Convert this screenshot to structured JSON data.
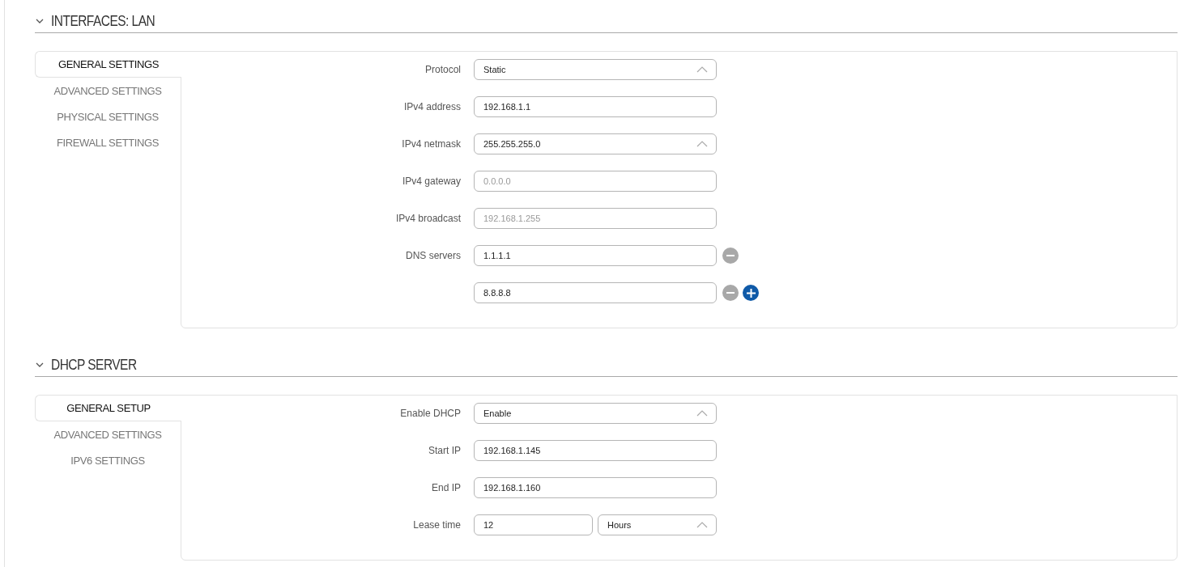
{
  "sections": [
    {
      "title": "INTERFACES: LAN",
      "expanded": true,
      "tabs": [
        {
          "label": "GENERAL SETTINGS",
          "selected": true
        },
        {
          "label": "ADVANCED SETTINGS",
          "selected": false
        },
        {
          "label": "PHYSICAL SETTINGS",
          "selected": false
        },
        {
          "label": "FIREWALL SETTINGS",
          "selected": false
        }
      ],
      "fields": [
        {
          "label": "Protocol",
          "kind": "select",
          "value": "Static"
        },
        {
          "label": "IPv4 address",
          "kind": "input",
          "value": "192.168.1.1"
        },
        {
          "label": "IPv4 netmask",
          "kind": "select",
          "value": "255.255.255.0"
        },
        {
          "label": "IPv4 gateway",
          "kind": "input",
          "placeholder": "0.0.0.0"
        },
        {
          "label": "IPv4 broadcast",
          "kind": "input",
          "placeholder": "192.168.1.255"
        },
        {
          "label": "DNS servers",
          "kind": "input",
          "value": "1.1.1.1",
          "actions": [
            {
              "kind": "remove"
            }
          ]
        },
        {
          "kind": "input",
          "value": "8.8.8.8",
          "actions": [
            {
              "kind": "remove"
            },
            {
              "kind": "add"
            }
          ]
        }
      ]
    },
    {
      "title": "DHCP SERVER",
      "expanded": true,
      "tabs": [
        {
          "label": "GENERAL SETUP",
          "selected": true
        },
        {
          "label": "ADVANCED SETTINGS",
          "selected": false
        },
        {
          "label": "IPV6 SETTINGS",
          "selected": false
        }
      ],
      "fields": [
        {
          "label": "Enable DHCP",
          "kind": "select",
          "value": "Enable"
        },
        {
          "label": "Start IP",
          "kind": "input",
          "value": "192.168.1.145"
        },
        {
          "label": "End IP",
          "kind": "input",
          "value": "192.168.1.160"
        },
        {
          "label": "Lease time",
          "kind": "combo",
          "value": "12",
          "unit": "Hours"
        }
      ]
    }
  ]
}
